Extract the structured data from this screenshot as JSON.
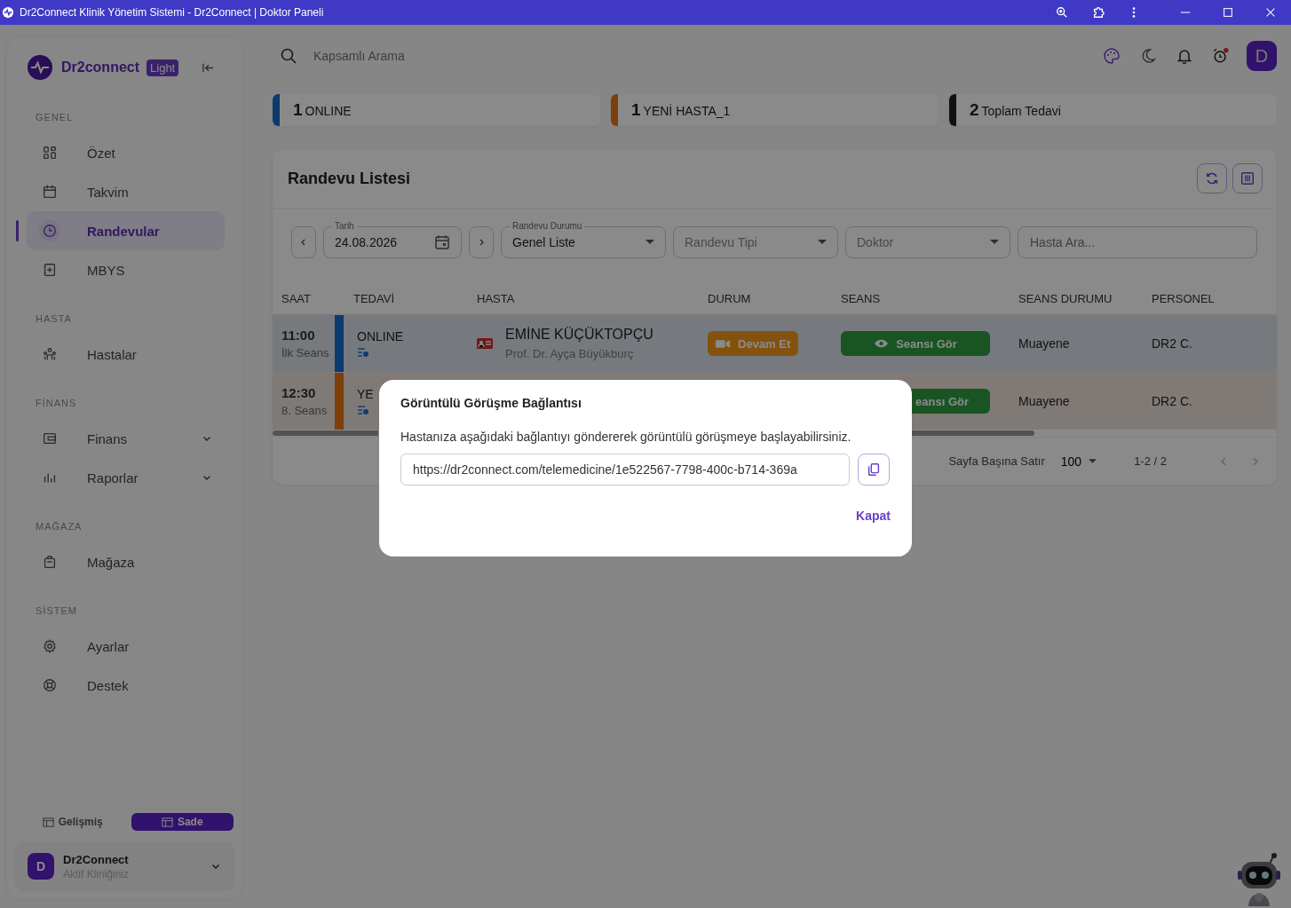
{
  "window": {
    "title": "Dr2Connect Klinik Yönetim Sistemi - Dr2Connect | Doktor Paneli"
  },
  "sidebar": {
    "brand": "Dr2connect",
    "badge": "Light",
    "sections": [
      {
        "title": "GENEL",
        "items": [
          {
            "label": "Özet",
            "kind": "grid",
            "selected": false
          },
          {
            "label": "Takvim",
            "kind": "calendar",
            "selected": false
          },
          {
            "label": "Randevular",
            "kind": "clock",
            "selected": true
          },
          {
            "label": "MBYS",
            "kind": "book",
            "selected": false
          }
        ]
      },
      {
        "title": "HASTA",
        "items": [
          {
            "label": "Hastalar",
            "kind": "people",
            "selected": false
          }
        ]
      },
      {
        "title": "FİNANS",
        "items": [
          {
            "label": "Finans",
            "kind": "wallet",
            "selected": false,
            "expanded": false
          },
          {
            "label": "Raporlar",
            "kind": "chart",
            "selected": false,
            "expanded": false
          }
        ]
      },
      {
        "title": "MAĞAZA",
        "items": [
          {
            "label": "Mağaza",
            "kind": "bag",
            "selected": false
          }
        ]
      },
      {
        "title": "SİSTEM",
        "items": [
          {
            "label": "Ayarlar",
            "kind": "gear",
            "selected": false
          },
          {
            "label": "Destek",
            "kind": "lifebuoy",
            "selected": false
          }
        ]
      }
    ],
    "view_modes": [
      {
        "label": "Gelişmiş",
        "selected": false
      },
      {
        "label": "Sade",
        "selected": true
      }
    ],
    "clinic": {
      "avatar": "D",
      "name": "Dr2Connect",
      "subtitle": "Aktif Kliniğiniz"
    }
  },
  "topbar": {
    "search": {
      "placeholder": "Kapsamlı Arama"
    },
    "avatar": "D"
  },
  "stats": [
    {
      "count": "1",
      "label": "ONLINE",
      "color": "#0d3a6f"
    },
    {
      "count": "1",
      "label": "YENİ HASTA_1",
      "color": "#7e3f0a"
    },
    {
      "count": "2",
      "label": "Toplam Tedavi",
      "color": "#111111"
    }
  ],
  "appointments": {
    "title": "Randevu Listesi",
    "date": {
      "label": "Tarih",
      "value": "24.08.2026"
    },
    "status_select": {
      "label": "Randevu Durumu",
      "value": "Genel Liste"
    },
    "type_select": {
      "placeholder": "Randevu Tipi"
    },
    "doctor_select": {
      "placeholder": "Doktor"
    },
    "search": {
      "placeholder": "Hasta Ara..."
    },
    "columns": [
      "SAAT",
      "TEDAVİ",
      "HASTA",
      "DURUM",
      "SEANS",
      "SEANS DURUMU",
      "PERSONEL"
    ],
    "rows": [
      {
        "time": "11:00",
        "session": "İlk Seans",
        "treatment": "ONLINE",
        "color": "#0d3a6f",
        "patient": "EMİNE KÜÇÜKTOPÇU",
        "doctor": "Prof. Dr. Ayça Büyükburç",
        "status": "Devam Et",
        "seans": "Seansı Gör",
        "seans_status": "Muayene",
        "staff": "DR2 C."
      },
      {
        "time": "12:30",
        "session": "8. Seans",
        "treatment": "YE",
        "color": "#7e3f0a",
        "seans": "eansı Gör",
        "seans_status": "Muayene",
        "staff": "DR2 C."
      }
    ],
    "pagination": {
      "rows_label": "Sayfa Başına Satır",
      "per_page": "100",
      "range": "1-2 / 2"
    }
  },
  "dialog": {
    "title": "Görüntülü Görüşme Bağlantısı",
    "text": "Hastanıza aşağıdaki bağlantıyı göndererek görüntülü görüşmeye başlayabilirsiniz.",
    "link": "https://dr2connect.com/telemedicine/1e522567-7798-400c-b714-369a",
    "close": "Kapat"
  }
}
